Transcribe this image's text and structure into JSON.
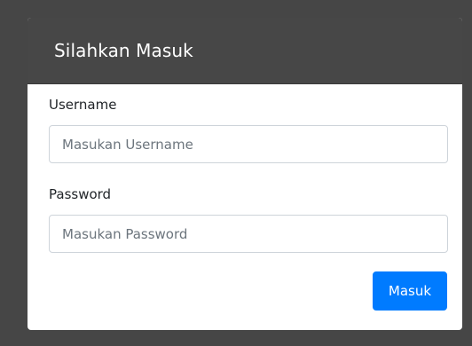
{
  "card": {
    "title": "Silahkan Masuk"
  },
  "form": {
    "username": {
      "label": "Username",
      "placeholder": "Masukan Username",
      "value": ""
    },
    "password": {
      "label": "Password",
      "placeholder": "Masukan Password",
      "value": ""
    },
    "submit_label": "Masuk"
  },
  "colors": {
    "background": "#464646",
    "header": "#474747",
    "primary": "#007bff"
  }
}
